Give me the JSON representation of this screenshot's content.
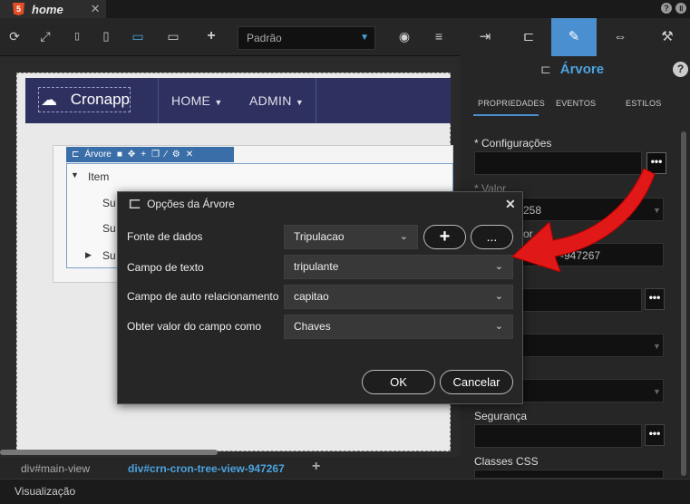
{
  "tab": {
    "title": "home",
    "icon": "html5-icon"
  },
  "toolbar": {
    "device_select": "Padrão"
  },
  "canvas": {
    "brand": "Cronapp",
    "nav": [
      "HOME",
      "ADMIN"
    ],
    "tree_toolbar_label": "Árvore",
    "tree_items": [
      "Item",
      "Su",
      "Su",
      "Su"
    ]
  },
  "bottom_tabs": [
    "div#main-view",
    "div#crn-cron-tree-view-947267"
  ],
  "statusbar": {
    "label": "Visualização"
  },
  "right_panel": {
    "title": "Árvore",
    "tabs": [
      "PROPRIEDADES",
      "EVENTOS",
      "ESTILOS"
    ],
    "labels": {
      "config": "* Configurações",
      "valor": "* Valor",
      "valor_partial": "258",
      "id_partial": "or",
      "id_value": "-947267",
      "seguranca": "Segurança",
      "classes_css": "Classes CSS"
    },
    "dots": "•••"
  },
  "dialog": {
    "title": "Opções da Árvore",
    "rows": [
      {
        "label": "Fonte de dados",
        "value": "Tripulacao"
      },
      {
        "label": "Campo de texto",
        "value": "tripulante"
      },
      {
        "label": "Campo de auto relacionamento",
        "value": "capitao"
      },
      {
        "label": "Obter valor do campo como",
        "value": "Chaves"
      }
    ],
    "add_label": "+",
    "more_label": "...",
    "ok_label": "OK",
    "cancel_label": "Cancelar"
  },
  "colors": {
    "accent": "#4a8fd0",
    "navbar": "#2e3160",
    "annotation": "#e01818"
  }
}
